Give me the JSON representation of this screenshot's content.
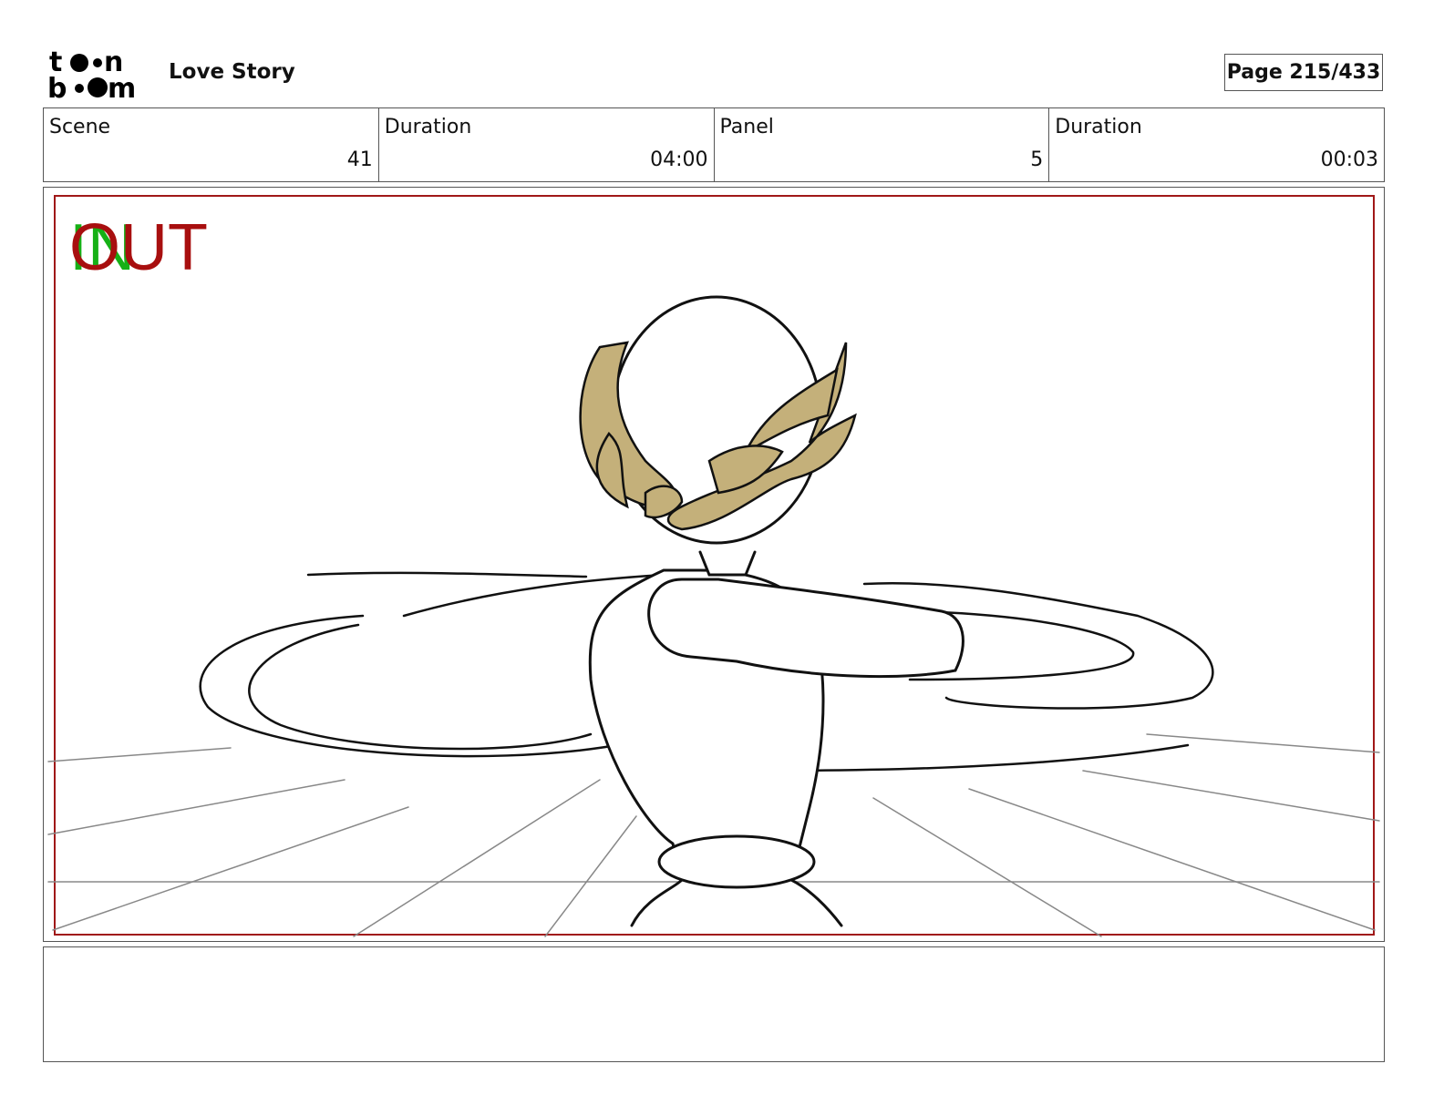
{
  "header": {
    "logo_text": "toon boom",
    "project_title": "Love Story",
    "page_label": "Page 215/433"
  },
  "info": [
    {
      "label": "Scene",
      "value": "41"
    },
    {
      "label": "Duration",
      "value": "04:00"
    },
    {
      "label": "Panel",
      "value": "5"
    },
    {
      "label": "Duration",
      "value": "00:03"
    }
  ],
  "panel": {
    "in_marker": "IN",
    "out_marker": "OUT",
    "frame_color": "#a01818",
    "laurel_color": "#c4b07a"
  },
  "notes": ""
}
